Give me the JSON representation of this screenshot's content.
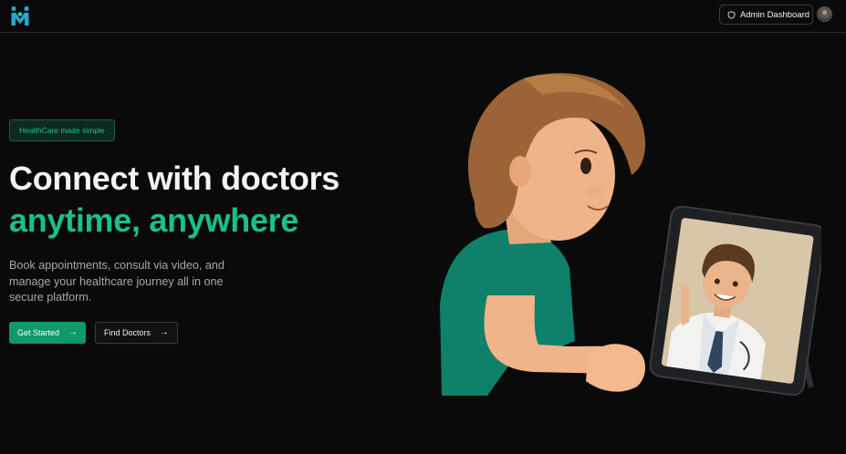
{
  "header": {
    "admin_label": "Admin Dashboard",
    "icons": {
      "logo": "people-logo-icon",
      "admin": "shield-icon",
      "avatar": "user-avatar"
    }
  },
  "hero": {
    "badge": "HealthCare made simple",
    "title_line1": "Connect with doctors",
    "title_line2": "anytime, anywhere",
    "description": "Book appointments, consult via video, and manage your healthcare journey all in one secure platform.",
    "primary_button": "Get Started",
    "secondary_button": "Find Doctors"
  },
  "colors": {
    "accent": "#19c08a",
    "primary_button": "#0f9a67",
    "background": "#0a0a0b"
  }
}
